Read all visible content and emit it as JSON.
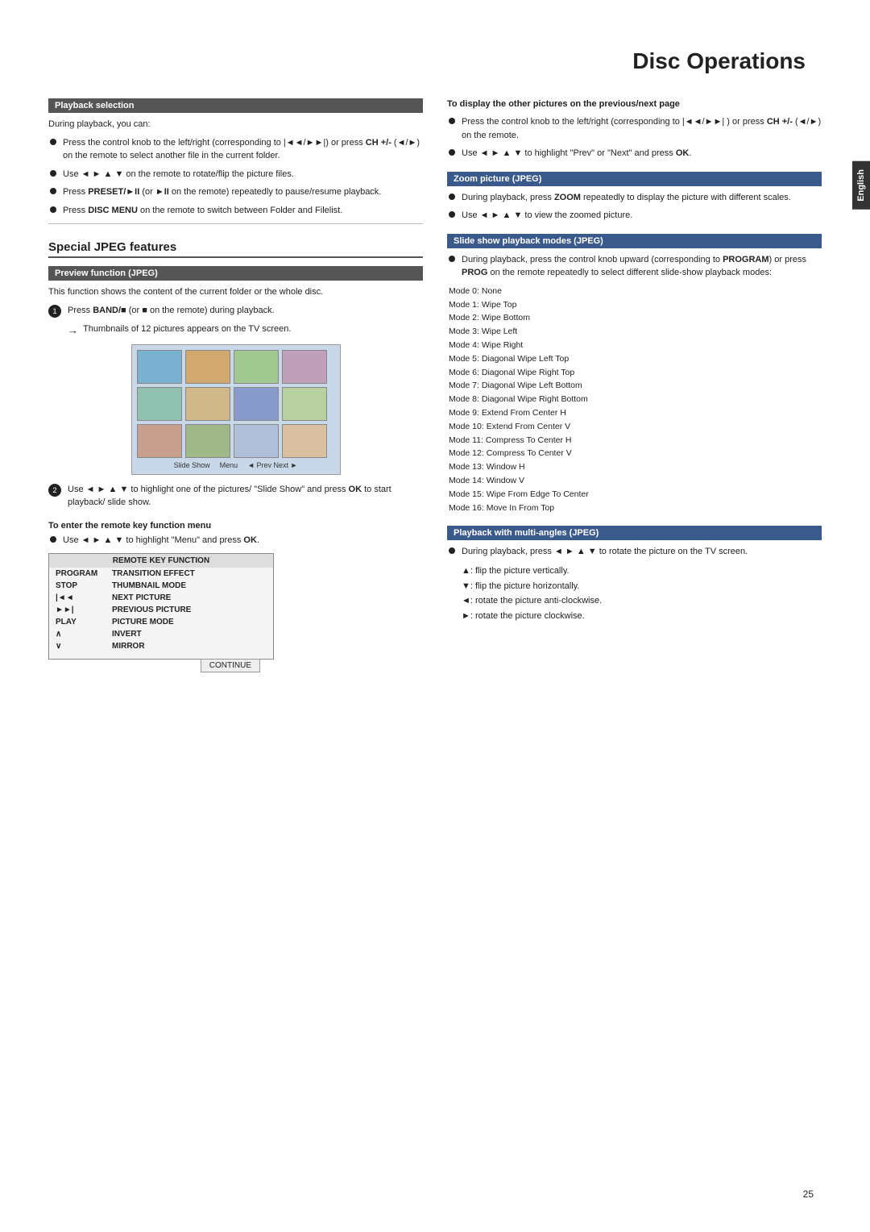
{
  "page": {
    "title": "Disc Operations",
    "number": "25",
    "language_tab": "English"
  },
  "left_col": {
    "playback_selection": {
      "header": "Playback selection",
      "intro": "During playback, you can:",
      "bullets": [
        {
          "text_parts": [
            {
              "text": "Press the control knob to the left/right (corresponding to ",
              "bold": false
            },
            {
              "text": "|◄◄/►►|",
              "bold": false
            },
            {
              "text": ") or press ",
              "bold": false
            },
            {
              "text": "CH +/-",
              "bold": true
            },
            {
              "text": " (◄/►) on the remote to select another file in the current folder.",
              "bold": false
            }
          ]
        },
        {
          "text_parts": [
            {
              "text": "Use ◄ ► ▲ ▼ on the remote to rotate/flip the picture files.",
              "bold": false
            }
          ]
        },
        {
          "text_parts": [
            {
              "text": "Press ",
              "bold": false
            },
            {
              "text": "PRESET/",
              "bold": true
            },
            {
              "text": "►II",
              "bold": true
            },
            {
              "text": " (or ",
              "bold": false
            },
            {
              "text": "►II",
              "bold": true
            },
            {
              "text": " on the remote) repeatedly to pause/resume playback.",
              "bold": false
            }
          ]
        },
        {
          "text_parts": [
            {
              "text": "Press ",
              "bold": false
            },
            {
              "text": "DISC MENU",
              "bold": true
            },
            {
              "text": " on the remote to switch between Folder and Filelist.",
              "bold": false
            }
          ]
        }
      ]
    },
    "special_jpeg": {
      "title": "Special JPEG features",
      "preview_header": "Preview function (JPEG)",
      "preview_intro": "This function shows the content of the current folder or the whole disc.",
      "step1": {
        "number": "1",
        "text_parts": [
          {
            "text": "Press ",
            "bold": false
          },
          {
            "text": "BAND/■",
            "bold": true
          },
          {
            "text": " (or ",
            "bold": false
          },
          {
            "text": "■",
            "bold": true
          },
          {
            "text": " on the remote) during playback.",
            "bold": false
          }
        ]
      },
      "step1_arrow": "Thumbnails of 12 pictures appears on the TV screen.",
      "thumbnail_bar": [
        "Slide Show",
        "Menu",
        "◄ Prev Next ►"
      ],
      "step2": {
        "number": "2",
        "text_parts": [
          {
            "text": "Use ◄ ► ▲ ▼ to highlight one of the pictures/ \"Slide Show\" and press ",
            "bold": false
          },
          {
            "text": "OK",
            "bold": true
          },
          {
            "text": " to start playback/ slide show.",
            "bold": false
          }
        ]
      }
    },
    "remote_menu": {
      "subheader": "To enter the remote key function menu",
      "intro_parts": [
        {
          "text": "Use ◄ ► ▲ ▼ to highlight \"Menu\" and press ",
          "bold": false
        },
        {
          "text": "OK",
          "bold": true
        },
        {
          "text": ".",
          "bold": false
        }
      ],
      "table_header": "REMOTE KEY FUNCTION",
      "rows": [
        {
          "key": "PROGRAM",
          "val": "TRANSITION EFFECT"
        },
        {
          "key": "STOP",
          "val": "THUMBNAIL MODE"
        },
        {
          "key": "|◄◄",
          "val": "NEXT PICTURE"
        },
        {
          "key": "►►|",
          "val": "PREVIOUS PICTURE"
        },
        {
          "key": "PLAY",
          "val": "PICTURE MODE"
        },
        {
          "key": "∧",
          "val": "INVERT"
        },
        {
          "key": "∨",
          "val": "MIRROR"
        }
      ],
      "continue_btn": "CONTINUE"
    }
  },
  "right_col": {
    "display_other": {
      "header": "To display the other pictures on the previous/next page",
      "bullets": [
        {
          "text_parts": [
            {
              "text": "Press the control knob to the left/right (corresponding to ",
              "bold": false
            },
            {
              "text": "|◄◄/►►|",
              "bold": false
            },
            {
              "text": " ) or press ",
              "bold": false
            },
            {
              "text": "CH +/-",
              "bold": true
            },
            {
              "text": " (◄/►) on the remote.",
              "bold": false
            }
          ]
        },
        {
          "text_parts": [
            {
              "text": "Use ◄ ► ▲ ▼ to highlight \"Prev\" or \"Next\" and press ",
              "bold": false
            },
            {
              "text": "OK",
              "bold": true
            },
            {
              "text": ".",
              "bold": false
            }
          ]
        }
      ]
    },
    "zoom_jpeg": {
      "header": "Zoom picture (JPEG)",
      "bullets": [
        {
          "text_parts": [
            {
              "text": "During playback, press ",
              "bold": false
            },
            {
              "text": "ZOOM",
              "bold": true
            },
            {
              "text": " repeatedly to display the picture with different scales.",
              "bold": false
            }
          ]
        },
        {
          "text_parts": [
            {
              "text": "Use ◄ ► ▲ ▼ to view the zoomed picture.",
              "bold": false
            }
          ]
        }
      ]
    },
    "slideshow_modes": {
      "header": "Slide show playback modes (JPEG)",
      "intro_parts": [
        {
          "text": "During playback, press the control knob upward (corresponding to ",
          "bold": false
        },
        {
          "text": "PROGRAM",
          "bold": true
        },
        {
          "text": ") or press ",
          "bold": false
        },
        {
          "text": "PROG",
          "bold": true
        },
        {
          "text": " on the remote repeatedly to select different slide-show playback modes:",
          "bold": false
        }
      ],
      "modes": [
        "Mode 0: None",
        "Mode 1: Wipe Top",
        "Mode 2: Wipe Bottom",
        "Mode 3: Wipe Left",
        "Mode 4: Wipe Right",
        "Mode 5: Diagonal Wipe Left Top",
        "Mode 6: Diagonal Wipe Right Top",
        "Mode 7: Diagonal Wipe Left Bottom",
        "Mode 8: Diagonal Wipe Right Bottom",
        "Mode 9: Extend From Center H",
        "Mode 10: Extend From Center V",
        "Mode 11: Compress To Center H",
        "Mode 12: Compress To Center V",
        "Mode 13: Window H",
        "Mode 14: Window V",
        "Mode 15: Wipe From Edge To Center",
        "Mode 16: Move In From Top"
      ]
    },
    "playback_multiangle": {
      "header": "Playback with multi-angles (JPEG)",
      "intro_parts": [
        {
          "text": "During playback, press ◄ ► ▲ ▼ to rotate the picture on the TV screen.",
          "bold": false
        }
      ],
      "sub_bullets": [
        "▲: flip the picture vertically.",
        "▼:  flip the picture horizontally.",
        "◄: rotate the picture anti-clockwise.",
        "►: rotate the picture clockwise."
      ]
    }
  }
}
